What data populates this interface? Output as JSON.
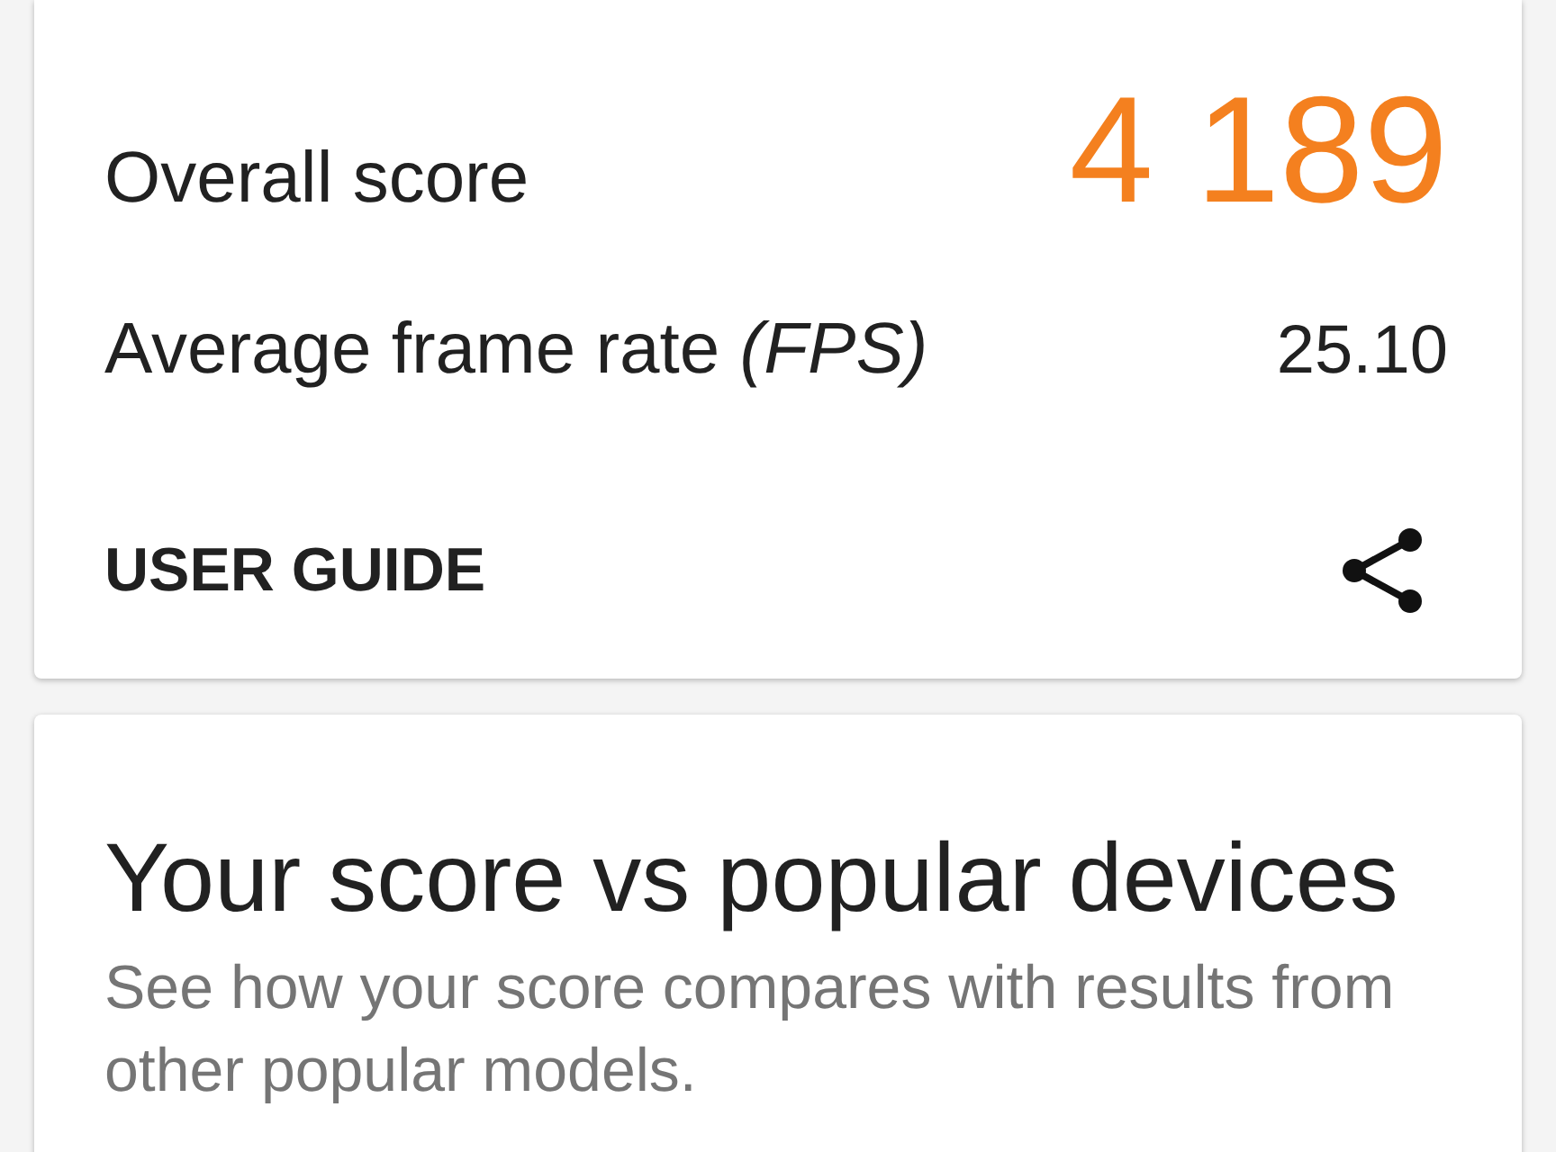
{
  "score_card": {
    "overall_score": {
      "label": "Overall score",
      "value": "4 189"
    },
    "frame_rate": {
      "label": "Average frame rate *(FPS)*",
      "value": "25.10"
    },
    "user_guide_link": "USER GUIDE"
  },
  "comparison_card": {
    "title": "Your score vs popular devices",
    "description": "See how your score compares with results from other popular models."
  }
}
